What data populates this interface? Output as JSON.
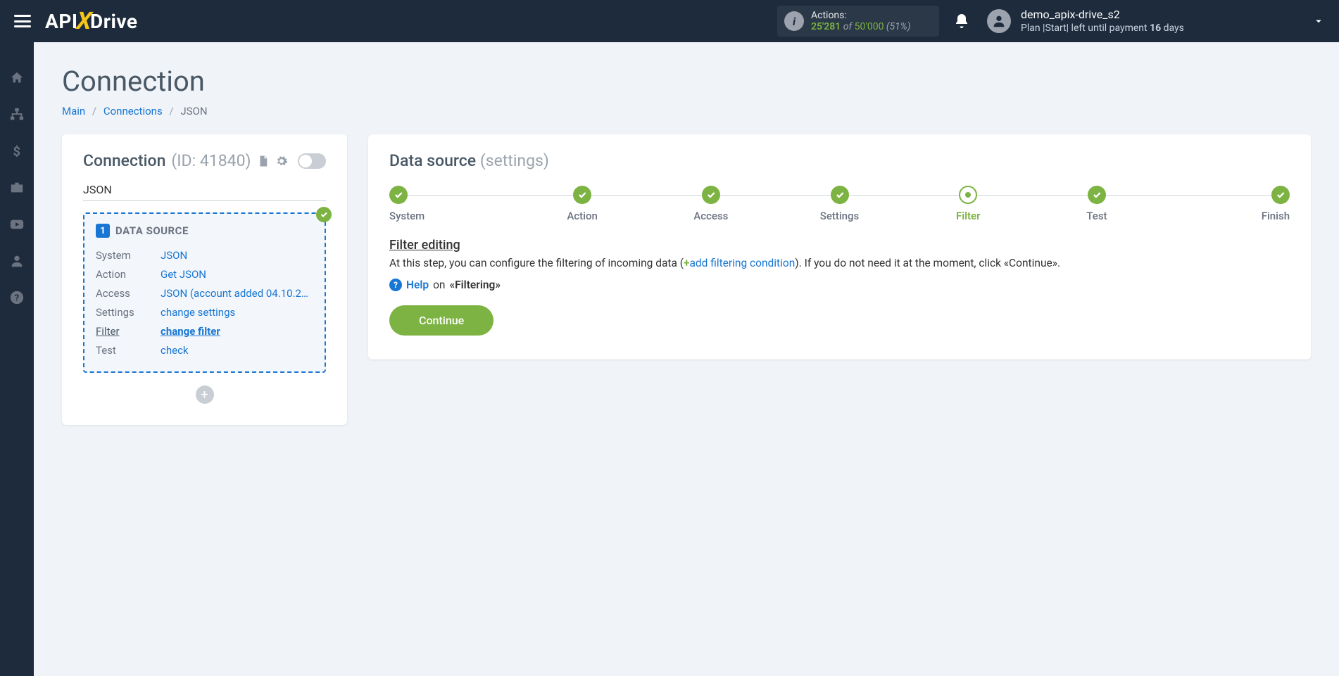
{
  "header": {
    "actions_label": "Actions:",
    "actions_used": "25'281",
    "actions_of": " of ",
    "actions_total": "50'000",
    "actions_pct": " (51%)",
    "username": "demo_apix-drive_s2",
    "plan_prefix": "Plan |Start| left until payment ",
    "plan_days": "16",
    "plan_suffix": " days"
  },
  "page": {
    "title": "Connection",
    "crumb_main": "Main",
    "crumb_connections": "Connections",
    "crumb_current": "JSON"
  },
  "left_card": {
    "title": "Connection",
    "id_label": "(ID: 41840)",
    "input_value": "JSON",
    "box_num": "1",
    "box_title": "DATA SOURCE",
    "rows": {
      "system_k": "System",
      "system_v": "JSON",
      "action_k": "Action",
      "action_v": "Get JSON",
      "access_k": "Access",
      "access_v": "JSON (account added 04.10.2…",
      "settings_k": "Settings",
      "settings_v": "change settings",
      "filter_k": "Filter",
      "filter_v": "change filter",
      "test_k": "Test",
      "test_v": "check"
    }
  },
  "right_card": {
    "title": "Data source",
    "subtitle": "(settings)",
    "steps": [
      "System",
      "Action",
      "Access",
      "Settings",
      "Filter",
      "Test",
      "Finish"
    ],
    "filter_title": "Filter editing",
    "desc_a": "At this step, you can configure the filtering of incoming data (",
    "desc_plus": "+",
    "desc_link": "add filtering condition",
    "desc_b": "). If you do not need it at the moment, click «Continue».",
    "help_word": "Help",
    "help_on": "on",
    "help_topic": "«Filtering»",
    "continue": "Continue"
  }
}
